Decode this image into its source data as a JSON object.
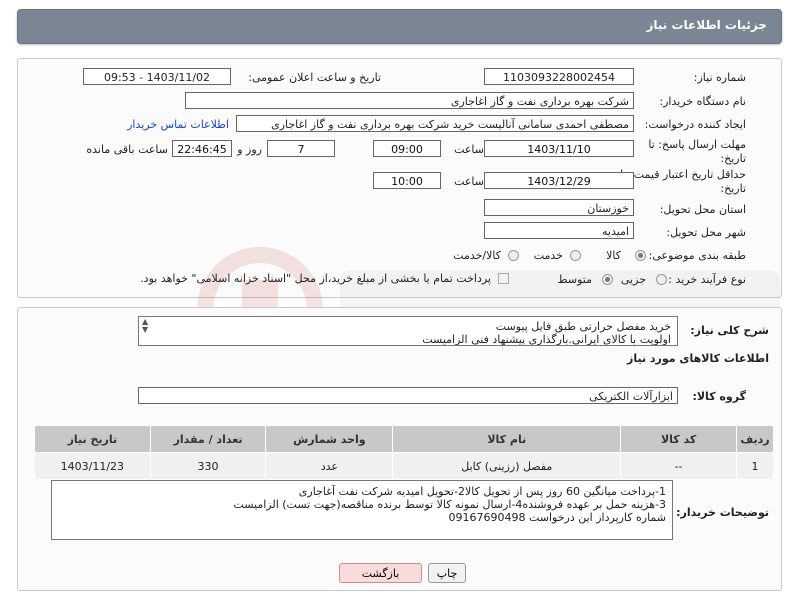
{
  "header": {
    "title": "جزئیات اطلاعات نیاز"
  },
  "form": {
    "need_number": {
      "label": "شماره نیاز:",
      "value": "1103093228002454"
    },
    "announce_datetime": {
      "label": "تاریخ و ساعت اعلان عمومی:",
      "value": "1403/11/02 - 09:53"
    },
    "buyer_org": {
      "label": "نام دستگاه خریدار:",
      "value": "شرکت بهره برداری نفت و گاز اغاجاری"
    },
    "requester": {
      "label": "ایجاد کننده درخواست:",
      "value": "مصطفی احمدی سامانی آنالیست خرید شرکت بهره برداری نفت و گاز اغاجاری",
      "contact_link": "اطلاعات تماس خریدار"
    },
    "reply_deadline": {
      "label_line1": "مهلت ارسال پاسخ: تا",
      "label_line2": "تاریخ:",
      "date": "1403/11/10",
      "time_label": "ساعت",
      "time": "09:00",
      "days": "7",
      "days_label": "روز و",
      "remaining": "22:46:45",
      "remaining_label": "ساعت باقی مانده"
    },
    "price_validity": {
      "label_line1": "حداقل تاریخ اعتبار قیمت: تا",
      "label_line2": "تاریخ:",
      "date": "1403/12/29",
      "time_label": "ساعت",
      "time": "10:00"
    },
    "province": {
      "label": "استان محل تحویل:",
      "value": "خوزستان"
    },
    "city": {
      "label": "شهر محل تحویل:",
      "value": "امیدیه"
    },
    "category": {
      "label": "طبقه بندی موضوعی:",
      "options": [
        "کالا",
        "خدمت",
        "کالا/خدمت"
      ],
      "selected": "کالا"
    },
    "purchase_process": {
      "label": "نوع فرآیند خرید :",
      "options": [
        "جزیی",
        "متوسط"
      ],
      "selected": "متوسط",
      "note": "پرداخت تمام یا بخشی از مبلغ خرید،از محل \"اسناد خزانه اسلامی\" خواهد بود."
    }
  },
  "general_description": {
    "label": "شرح کلی نیاز:",
    "lines": [
      "خرید مفصل حرارتی طبق فایل پیوست",
      "اولویت با کالای ایرانی.بارگذاری پیشنهاد فنی الزامیست"
    ]
  },
  "goods_info": {
    "title": "اطلاعات کالاهای مورد نیاز",
    "group_label": "گروه کالا:",
    "group_value": "ابزارآلات الکتریکی",
    "table": {
      "headers": [
        "ردیف",
        "کد کالا",
        "نام کالا",
        "واحد شمارش",
        "تعداد / مقدار",
        "تاریخ نیاز"
      ],
      "rows": [
        [
          "1",
          "--",
          "مفصل (رزینی) کابل",
          "عدد",
          "330",
          "1403/11/23"
        ]
      ]
    }
  },
  "buyer_notes": {
    "label": "توضیحات خریدار:",
    "lines": [
      "1-پرداخت میانگین 60 روز پس از تحویل کالا2-تحویل امیدیه شرکت نفت آغاجاری",
      "3-هزینه حمل بر عهده فروشنده4-ارسال نمونه کالا توسط برنده مناقصه(جهت تست) الزامیست",
      "شماره کارپرداز این درخواست 09167690498"
    ]
  },
  "buttons": {
    "print": "چاپ",
    "back": "بازگشت"
  },
  "colors": {
    "header": "#7b8695",
    "link": "#1a44c8",
    "table_header": "#c8c8c8"
  }
}
